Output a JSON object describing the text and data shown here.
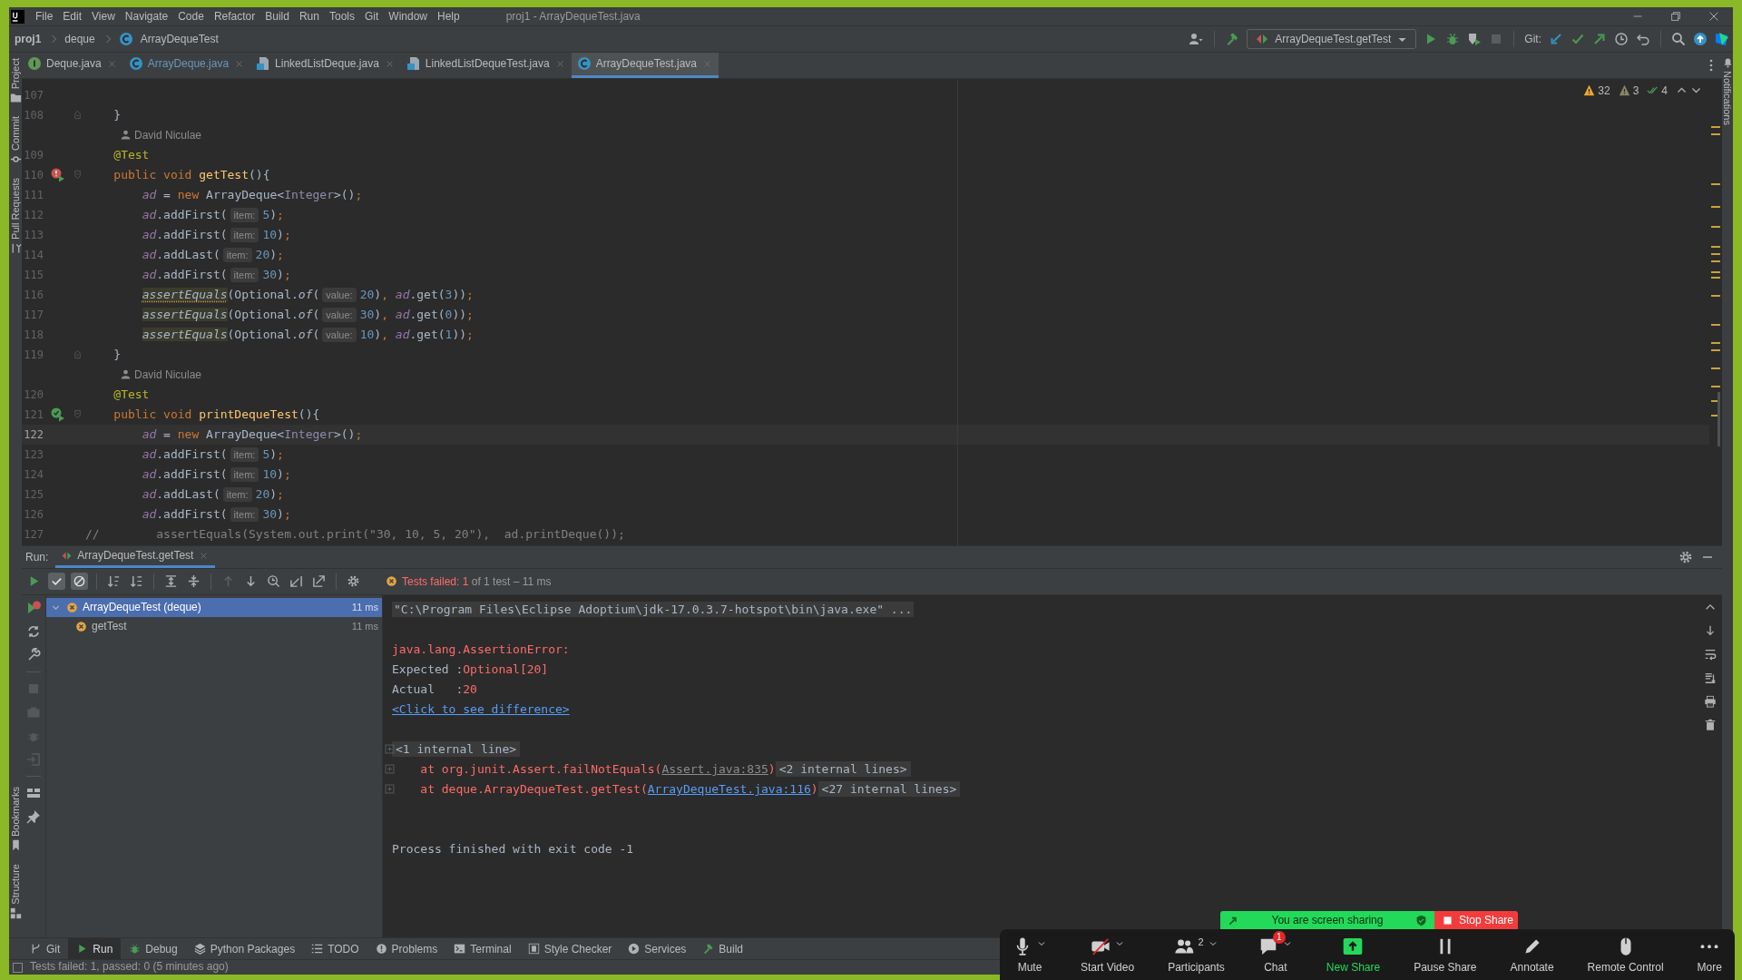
{
  "menu": [
    "File",
    "Edit",
    "View",
    "Navigate",
    "Code",
    "Refactor",
    "Build",
    "Run",
    "Tools",
    "Git",
    "Window",
    "Help"
  ],
  "window_title": "proj1 - ArrayDequeTest.java",
  "breadcrumbs": [
    "proj1",
    "deque",
    "ArrayDequeTest"
  ],
  "run_config": "ArrayDequeTest.getTest",
  "git_label": "Git:",
  "editor_tabs": [
    {
      "label": "Deque.java",
      "kind": "interface",
      "modified": false,
      "selected": false
    },
    {
      "label": "ArrayDeque.java",
      "kind": "class",
      "modified": true,
      "selected": false
    },
    {
      "label": "LinkedListDeque.java",
      "kind": "java-file",
      "modified": false,
      "selected": false
    },
    {
      "label": "LinkedListDequeTest.java",
      "kind": "java-file",
      "modified": false,
      "selected": false
    },
    {
      "label": "ArrayDequeTest.java",
      "kind": "class",
      "modified": false,
      "selected": true
    }
  ],
  "inspections": [
    {
      "kind": "warning",
      "count": "32"
    },
    {
      "kind": "weak-warning",
      "count": "3"
    },
    {
      "kind": "typo",
      "count": "4"
    }
  ],
  "left_strip": {
    "top": [
      "Project",
      "Commit",
      "Pull Requests"
    ],
    "bottom": [
      "Bookmarks",
      "Structure"
    ]
  },
  "right_strip": [
    "Notifications"
  ],
  "editor": {
    "lines": [
      {
        "kind": "code",
        "number": "107",
        "current": false
      },
      {
        "kind": "code",
        "number": "108",
        "current": false,
        "fold": {
          "kind": "end"
        },
        "tokens": [
          {
            "text": "    }",
            "kind": "plain"
          }
        ]
      },
      {
        "kind": "author",
        "text": "David Niculae"
      },
      {
        "kind": "code",
        "number": "109",
        "current": false,
        "tokens": [
          {
            "text": "    @Test",
            "kind": "annotation"
          }
        ]
      },
      {
        "kind": "code",
        "number": "110",
        "current": false,
        "gutter": {
          "kind": "failed"
        },
        "fold": {
          "kind": "start"
        },
        "tokens": [
          {
            "text": "    public void ",
            "kind": "keyword"
          },
          {
            "text": "getTest",
            "kind": "method"
          },
          {
            "text": "(){",
            "kind": "plain"
          }
        ]
      },
      {
        "kind": "code",
        "number": "111",
        "current": false,
        "tokens": [
          {
            "text": "        ad",
            "kind": "field"
          },
          {
            "text": " = ",
            "kind": "plain"
          },
          {
            "text": "new ",
            "kind": "keyword"
          },
          {
            "text": "ArrayDeque<",
            "kind": "plain"
          },
          {
            "text": "Integer",
            "kind": "generic"
          },
          {
            "text": ">()",
            "kind": "plain"
          },
          {
            "text": ";",
            "kind": "keyword"
          }
        ]
      },
      {
        "kind": "code",
        "number": "112",
        "current": false,
        "tokens": [
          {
            "text": "        ad",
            "kind": "field"
          },
          {
            "text": ".addFirst(",
            "kind": "plain"
          },
          {
            "text": "item:",
            "kind": "hint"
          },
          {
            "text": "5",
            "kind": "number"
          },
          {
            "text": ")",
            "kind": "plain"
          },
          {
            "text": ";",
            "kind": "keyword"
          }
        ]
      },
      {
        "kind": "code",
        "number": "113",
        "current": false,
        "tokens": [
          {
            "text": "        ad",
            "kind": "field"
          },
          {
            "text": ".addFirst(",
            "kind": "plain"
          },
          {
            "text": "item:",
            "kind": "hint"
          },
          {
            "text": "10",
            "kind": "number"
          },
          {
            "text": ")",
            "kind": "plain"
          },
          {
            "text": ";",
            "kind": "keyword"
          }
        ]
      },
      {
        "kind": "code",
        "number": "114",
        "current": false,
        "tokens": [
          {
            "text": "        ad",
            "kind": "field"
          },
          {
            "text": ".addLast(",
            "kind": "plain"
          },
          {
            "text": "item:",
            "kind": "hint"
          },
          {
            "text": "20",
            "kind": "number"
          },
          {
            "text": ")",
            "kind": "plain"
          },
          {
            "text": ";",
            "kind": "keyword"
          }
        ]
      },
      {
        "kind": "code",
        "number": "115",
        "current": false,
        "tokens": [
          {
            "text": "        ad",
            "kind": "field"
          },
          {
            "text": ".addFirst(",
            "kind": "plain"
          },
          {
            "text": "item:",
            "kind": "hint"
          },
          {
            "text": "30",
            "kind": "number"
          },
          {
            "text": ")",
            "kind": "plain"
          },
          {
            "text": ";",
            "kind": "keyword"
          }
        ]
      },
      {
        "kind": "code",
        "number": "116",
        "current": false,
        "tokens": [
          {
            "text": "        assertEquals",
            "kind": "assert-warning"
          },
          {
            "text": "(Optional.",
            "kind": "plain"
          },
          {
            "text": "of",
            "kind": "static"
          },
          {
            "text": "(",
            "kind": "plain"
          },
          {
            "text": "value:",
            "kind": "hint"
          },
          {
            "text": "20",
            "kind": "number"
          },
          {
            "text": ")",
            "kind": "plain"
          },
          {
            "text": ", ",
            "kind": "keyword"
          },
          {
            "text": "ad",
            "kind": "field"
          },
          {
            "text": ".get(",
            "kind": "plain"
          },
          {
            "text": "3",
            "kind": "number"
          },
          {
            "text": "))",
            "kind": "plain"
          },
          {
            "text": ";",
            "kind": "keyword"
          }
        ]
      },
      {
        "kind": "code",
        "number": "117",
        "current": false,
        "tokens": [
          {
            "text": "        assertEquals",
            "kind": "assert"
          },
          {
            "text": "(Optional.",
            "kind": "plain"
          },
          {
            "text": "of",
            "kind": "static"
          },
          {
            "text": "(",
            "kind": "plain"
          },
          {
            "text": "value:",
            "kind": "hint"
          },
          {
            "text": "30",
            "kind": "number"
          },
          {
            "text": ")",
            "kind": "plain"
          },
          {
            "text": ", ",
            "kind": "keyword"
          },
          {
            "text": "ad",
            "kind": "field"
          },
          {
            "text": ".get(",
            "kind": "plain"
          },
          {
            "text": "0",
            "kind": "number"
          },
          {
            "text": "))",
            "kind": "plain"
          },
          {
            "text": ";",
            "kind": "keyword"
          }
        ]
      },
      {
        "kind": "code",
        "number": "118",
        "current": false,
        "tokens": [
          {
            "text": "        assertEquals",
            "kind": "assert"
          },
          {
            "text": "(Optional.",
            "kind": "plain"
          },
          {
            "text": "of",
            "kind": "static"
          },
          {
            "text": "(",
            "kind": "plain"
          },
          {
            "text": "value:",
            "kind": "hint"
          },
          {
            "text": "10",
            "kind": "number"
          },
          {
            "text": ")",
            "kind": "plain"
          },
          {
            "text": ", ",
            "kind": "keyword"
          },
          {
            "text": "ad",
            "kind": "field"
          },
          {
            "text": ".get(",
            "kind": "plain"
          },
          {
            "text": "1",
            "kind": "number"
          },
          {
            "text": "))",
            "kind": "plain"
          },
          {
            "text": ";",
            "kind": "keyword"
          }
        ]
      },
      {
        "kind": "code",
        "number": "119",
        "current": false,
        "fold": {
          "kind": "end"
        },
        "tokens": [
          {
            "text": "    }",
            "kind": "plain"
          }
        ]
      },
      {
        "kind": "author",
        "text": "David Niculae"
      },
      {
        "kind": "code",
        "number": "120",
        "current": false,
        "tokens": [
          {
            "text": "    @Test",
            "kind": "annotation"
          }
        ]
      },
      {
        "kind": "code",
        "number": "121",
        "current": false,
        "gutter": {
          "kind": "passed"
        },
        "fold": {
          "kind": "start"
        },
        "tokens": [
          {
            "text": "    public void ",
            "kind": "keyword"
          },
          {
            "text": "printDequeTest",
            "kind": "method"
          },
          {
            "text": "(){",
            "kind": "plain"
          }
        ]
      },
      {
        "kind": "code",
        "number": "122",
        "current": true,
        "tokens": [
          {
            "text": "        ad",
            "kind": "field"
          },
          {
            "text": " = ",
            "kind": "plain"
          },
          {
            "text": "new ",
            "kind": "keyword"
          },
          {
            "text": "ArrayDeque<",
            "kind": "plain"
          },
          {
            "text": "Integer",
            "kind": "generic"
          },
          {
            "text": ">()",
            "kind": "plain"
          },
          {
            "text": ";",
            "kind": "keyword"
          }
        ]
      },
      {
        "kind": "code",
        "number": "123",
        "current": false,
        "tokens": [
          {
            "text": "        ad",
            "kind": "field"
          },
          {
            "text": ".addFirst(",
            "kind": "plain"
          },
          {
            "text": "item:",
            "kind": "hint"
          },
          {
            "text": "5",
            "kind": "number"
          },
          {
            "text": ")",
            "kind": "plain"
          },
          {
            "text": ";",
            "kind": "keyword"
          }
        ]
      },
      {
        "kind": "code",
        "number": "124",
        "current": false,
        "tokens": [
          {
            "text": "        ad",
            "kind": "field"
          },
          {
            "text": ".addFirst(",
            "kind": "plain"
          },
          {
            "text": "item:",
            "kind": "hint"
          },
          {
            "text": "10",
            "kind": "number"
          },
          {
            "text": ")",
            "kind": "plain"
          },
          {
            "text": ";",
            "kind": "keyword"
          }
        ]
      },
      {
        "kind": "code",
        "number": "125",
        "current": false,
        "tokens": [
          {
            "text": "        ad",
            "kind": "field"
          },
          {
            "text": ".addLast(",
            "kind": "plain"
          },
          {
            "text": "item:",
            "kind": "hint"
          },
          {
            "text": "20",
            "kind": "number"
          },
          {
            "text": ")",
            "kind": "plain"
          },
          {
            "text": ";",
            "kind": "keyword"
          }
        ]
      },
      {
        "kind": "code",
        "number": "126",
        "current": false,
        "tokens": [
          {
            "text": "        ad",
            "kind": "field"
          },
          {
            "text": ".addFirst(",
            "kind": "plain"
          },
          {
            "text": "item:",
            "kind": "hint"
          },
          {
            "text": "30",
            "kind": "number"
          },
          {
            "text": ")",
            "kind": "plain"
          },
          {
            "text": ";",
            "kind": "keyword"
          }
        ]
      },
      {
        "kind": "code",
        "number": "127",
        "current": false,
        "tokens": [
          {
            "text": "//        assertEquals(System.out.print(\"30, 10, 5, 20\"),  ad.printDeque());",
            "kind": "comment"
          }
        ]
      }
    ]
  },
  "run": {
    "label": "Run:",
    "tab": "ArrayDequeTest.getTest",
    "status": {
      "failed": "Tests failed: 1",
      "rest": "of 1 test – 11 ms"
    },
    "tree": [
      {
        "name": "ArrayDequeTest (deque)",
        "kind": "failed",
        "time": "11 ms",
        "selected": true,
        "expanded": true,
        "children": [
          {
            "name": "getTest",
            "kind": "failed",
            "time": "11 ms",
            "selected": false
          }
        ]
      }
    ],
    "console": [
      {
        "kind": "command",
        "text": "\"C:\\Program Files\\Eclipse Adoptium\\jdk-17.0.3.7-hotspot\\bin\\java.exe\" ..."
      },
      {
        "kind": "blank"
      },
      {
        "kind": "error",
        "text": "java.lang.AssertionError:"
      },
      {
        "kind": "compare",
        "label": "Expected :",
        "value": "Optional[20]"
      },
      {
        "kind": "compare",
        "label": "Actual   :",
        "value": "20"
      },
      {
        "kind": "link",
        "text": "<Click to see difference>"
      },
      {
        "kind": "blank"
      },
      {
        "kind": "folded",
        "text": "<1 internal line>"
      },
      {
        "kind": "trace",
        "prefix": "    at org.junit.Assert.failNotEquals(",
        "link": {
          "text": "Assert.java:835",
          "kind": "library"
        },
        "suffix": ")",
        "folded": "<2 internal lines>"
      },
      {
        "kind": "trace",
        "prefix": "    at deque.ArrayDequeTest.getTest(",
        "link": {
          "text": "ArrayDequeTest.java:116",
          "kind": "project"
        },
        "suffix": ")",
        "folded": "<27 internal lines>"
      },
      {
        "kind": "blank"
      },
      {
        "kind": "blank"
      },
      {
        "kind": "plain",
        "text": "Process finished with exit code -1"
      }
    ]
  },
  "tool_tabs": [
    {
      "label": "Git",
      "kind": "branch",
      "selected": false
    },
    {
      "label": "Run",
      "kind": "play",
      "selected": true
    },
    {
      "label": "Debug",
      "kind": "bug",
      "selected": false
    },
    {
      "label": "Python Packages",
      "kind": "layers",
      "selected": false
    },
    {
      "label": "TODO",
      "kind": "list",
      "selected": false
    },
    {
      "label": "Problems",
      "kind": "problems",
      "selected": false
    },
    {
      "label": "Terminal",
      "kind": "terminal",
      "selected": false
    },
    {
      "label": "Style Checker",
      "kind": "checker",
      "selected": false
    },
    {
      "label": "Services",
      "kind": "services",
      "selected": false
    },
    {
      "label": "Build",
      "kind": "hammer",
      "selected": false
    }
  ],
  "status_bar": "Tests failed: 1, passed: 0 (5 minutes ago)",
  "share_bar": {
    "label": "You are screen sharing",
    "stop": "Stop Share"
  },
  "meeting_controls": [
    {
      "label": "Mute",
      "kind": "mic",
      "caret": true
    },
    {
      "label": "Start Video",
      "kind": "video-off",
      "caret": true
    },
    {
      "label": "Participants",
      "kind": "people",
      "count": "2",
      "caret": true
    },
    {
      "label": "Chat",
      "kind": "chat",
      "badge": "1",
      "caret": true
    },
    {
      "label": "New Share",
      "kind": "share",
      "caret": false
    },
    {
      "label": "Pause Share",
      "kind": "pause",
      "caret": false
    },
    {
      "label": "Annotate",
      "kind": "pencil",
      "caret": false
    },
    {
      "label": "Remote Control",
      "kind": "mouse",
      "caret": false
    },
    {
      "label": "More",
      "kind": "dots",
      "caret": false
    }
  ]
}
